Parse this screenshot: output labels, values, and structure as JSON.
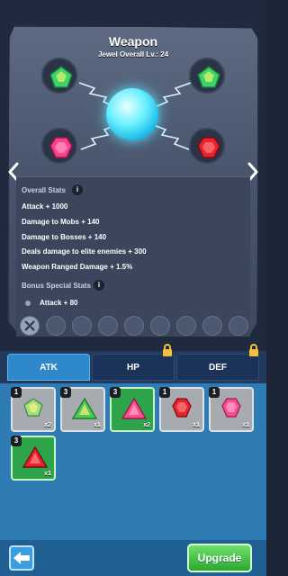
{
  "header": {
    "title": "Weapon",
    "subtitle": "Jewel Overall Lv.: 24"
  },
  "sockets": [
    {
      "name": "green-pentagon-gem-icon",
      "color": "#3ed26a"
    },
    {
      "name": "green-pentagon-gem-icon",
      "color": "#3ed26a"
    },
    {
      "name": "pink-gem-icon",
      "color": "#ff3f87"
    },
    {
      "name": "red-gem-icon",
      "color": "#e8222e"
    }
  ],
  "overall_stats": {
    "heading": "Overall Stats",
    "info": "i",
    "lines": [
      "Attack + 1000",
      "Damage to Mobs + 140",
      "Damage to Bosses + 140",
      "Deals damage to elite enemies + 300",
      "Weapon Ranged Damage + 1.5%"
    ]
  },
  "bonus_stats": {
    "heading": "Bonus Special Stats",
    "info": "i",
    "lines": [
      "Attack + 80"
    ]
  },
  "tabs": [
    {
      "label": "ATK",
      "active": true,
      "locked": false
    },
    {
      "label": "HP",
      "active": false,
      "locked": true
    },
    {
      "label": "DEF",
      "active": false,
      "locked": true
    }
  ],
  "gems": [
    {
      "level": "1",
      "count": "x2",
      "kind": "green-pentagon",
      "card": "gray"
    },
    {
      "level": "3",
      "count": "x1",
      "kind": "green-triangle",
      "card": "gray"
    },
    {
      "level": "3",
      "count": "x2",
      "kind": "pink-triangle",
      "card": "green"
    },
    {
      "level": "1",
      "count": "x1",
      "kind": "red",
      "card": "gray"
    },
    {
      "level": "1",
      "count": "x1",
      "kind": "pink",
      "card": "gray"
    },
    {
      "level": "3",
      "count": "x1",
      "kind": "red-triangle",
      "card": "green"
    }
  ],
  "buttons": {
    "upgrade": "Upgrade"
  }
}
